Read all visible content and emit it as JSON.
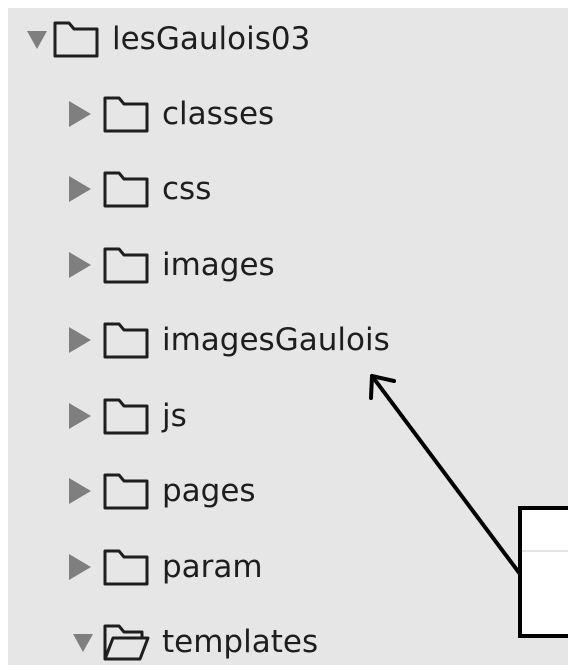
{
  "tree": {
    "root": {
      "label": "lesGaulois03",
      "toggle_icon": "triangle-down-icon",
      "folder_icon": "folder-closed-icon"
    },
    "children": [
      {
        "label": "classes",
        "toggle_icon": "triangle-right-icon",
        "folder_icon": "folder-closed-icon"
      },
      {
        "label": "css",
        "toggle_icon": "triangle-right-icon",
        "folder_icon": "folder-closed-icon"
      },
      {
        "label": "images",
        "toggle_icon": "triangle-right-icon",
        "folder_icon": "folder-closed-icon"
      },
      {
        "label": "imagesGaulois",
        "toggle_icon": "triangle-right-icon",
        "folder_icon": "folder-closed-icon"
      },
      {
        "label": "js",
        "toggle_icon": "triangle-right-icon",
        "folder_icon": "folder-closed-icon"
      },
      {
        "label": "pages",
        "toggle_icon": "triangle-right-icon",
        "folder_icon": "folder-closed-icon"
      },
      {
        "label": "param",
        "toggle_icon": "triangle-right-icon",
        "folder_icon": "folder-closed-icon"
      },
      {
        "label": "templates",
        "toggle_icon": "triangle-down-icon",
        "folder_icon": "folder-open-icon"
      }
    ]
  },
  "colors": {
    "panel_background": "#e6e6e6",
    "text": "#1e1e1e",
    "toggle": "#7f7f7f",
    "folder_outline": "#1e1e1e",
    "annotation": "#000000"
  },
  "annotation": {
    "arrow_icon": "arrow-pointer-icon",
    "target": "imagesGaulois"
  }
}
